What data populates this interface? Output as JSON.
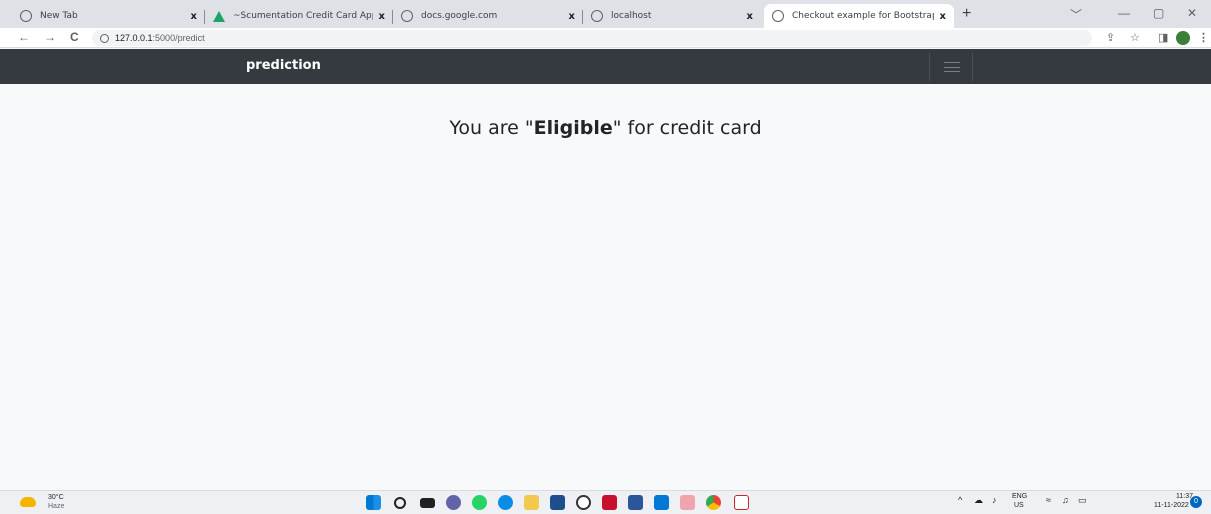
{
  "browser": {
    "tabs": [
      {
        "title": "New Tab"
      },
      {
        "title": "~Scumentation Credit Card Appr"
      },
      {
        "title": "docs.google.com"
      },
      {
        "title": "localhost"
      },
      {
        "title": "Checkout example for Bootstrap"
      }
    ],
    "new_tab": "+",
    "controls": {
      "dropdown": "﹀",
      "minimize": "—",
      "maximize": "▢",
      "close": "✕"
    },
    "address": {
      "host": "127.0.0.1",
      "path": ":5000/predict"
    },
    "nav": {
      "back": "←",
      "forward": "→",
      "reload": "C"
    },
    "close_glyph": "x"
  },
  "page": {
    "brand": "prediction",
    "heading_prefix": "You are \"",
    "heading_bold": "Eligible",
    "heading_suffix": "\" for credit card"
  },
  "taskbar": {
    "weather_temp": "30°C",
    "weather_desc": "Haze",
    "lang_line1": "ENG",
    "lang_line2": "US",
    "time": "11:37",
    "date": "11-11-2022",
    "notifications": "0"
  },
  "colors": {
    "navbar": "#343a40",
    "page_bg": "#f8f9fa"
  }
}
